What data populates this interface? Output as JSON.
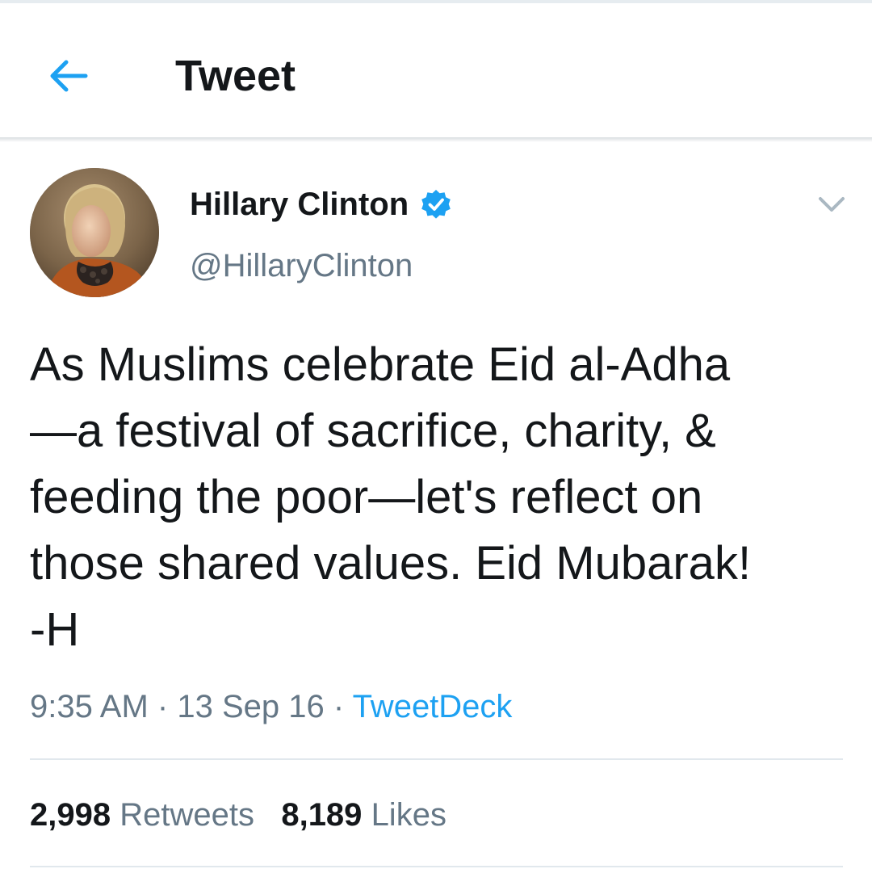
{
  "header": {
    "back_icon": "arrow-left-icon",
    "title": "Tweet"
  },
  "tweet": {
    "author": {
      "display_name": "Hillary Clinton",
      "handle": "@HillaryClinton",
      "verified_icon": "verified-badge-icon",
      "avatar_icon": "avatar-photo"
    },
    "menu_icon": "chevron-down-icon",
    "text": "As Muslims celebrate Eid al-Adha\n—a festival of sacrifice, charity, &\nfeeding the poor—let's reflect on\nthose shared values. Eid Mubarak!\n-H",
    "time": "9:35 AM",
    "separator": "·",
    "date": "13 Sep 16",
    "source": "TweetDeck"
  },
  "stats": {
    "retweets_count": "2,998",
    "retweets_label": "Retweets",
    "likes_count": "8,189",
    "likes_label": "Likes"
  },
  "colors": {
    "accent": "#1da1f2",
    "secondary_text": "#657786",
    "primary_text": "#14171a",
    "divider": "#e1e8ed"
  }
}
